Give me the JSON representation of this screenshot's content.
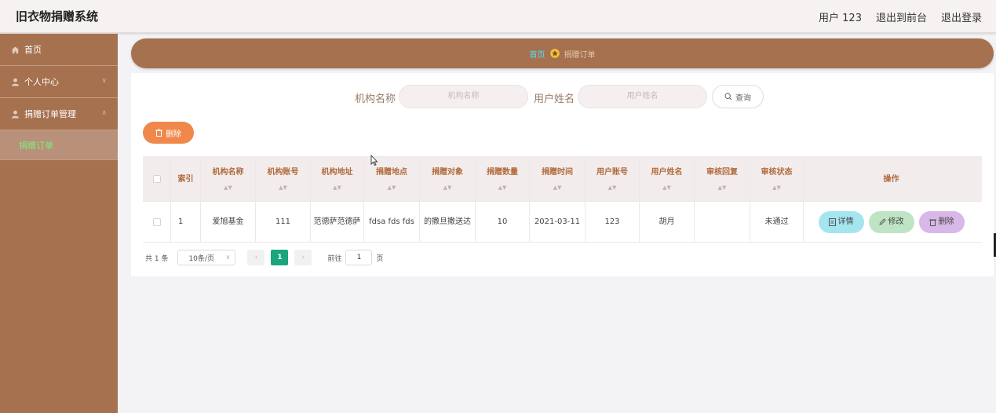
{
  "header": {
    "title": "旧衣物捐赠系统",
    "user": "用户 123",
    "to_front": "退出到前台",
    "logout": "退出登录"
  },
  "sidebar": {
    "items": [
      {
        "label": "首页",
        "icon": "home-icon"
      },
      {
        "label": "个人中心",
        "icon": "user-icon"
      },
      {
        "label": "捐赠订单管理",
        "icon": "user-icon"
      }
    ],
    "subitems": [
      {
        "label": "捐赠订单"
      }
    ]
  },
  "breadcrumb": {
    "home": "首页",
    "current": "捐赠订单"
  },
  "search": {
    "org_label": "机构名称",
    "org_placeholder": "机构名称",
    "user_label": "用户姓名",
    "user_placeholder": "用户姓名",
    "query": "查询"
  },
  "toolbar": {
    "delete": "删除"
  },
  "table": {
    "columns": [
      "索引",
      "机构名称",
      "机构账号",
      "机构地址",
      "捐赠地点",
      "捐赠对象",
      "捐赠数量",
      "捐赠时间",
      "用户账号",
      "用户姓名",
      "审核回复",
      "审核状态",
      "操作"
    ],
    "rows": [
      {
        "index": "1",
        "org_name": "爱旭基金",
        "org_account": "111",
        "org_address": "范德萨范德萨",
        "place": "fdsa fds fds",
        "target": "的撒旦撒送达",
        "quantity": "10",
        "time": "2021-03-11",
        "user_account": "123",
        "user_name": "胡月",
        "review_reply": "",
        "review_status": "未通过"
      }
    ],
    "actions": {
      "detail": "详情",
      "edit": "修改",
      "delete": "删除"
    }
  },
  "pagination": {
    "total": "共 1 条",
    "page_size": "10条/页",
    "current_page": "1",
    "goto_label": "前往",
    "goto_value": "1",
    "page_unit": "页"
  },
  "colors": {
    "brand": "#a5714f",
    "active_menu_text": "#7cf17c",
    "delete_button": "#f0884b",
    "page_active": "#1aa57e"
  }
}
